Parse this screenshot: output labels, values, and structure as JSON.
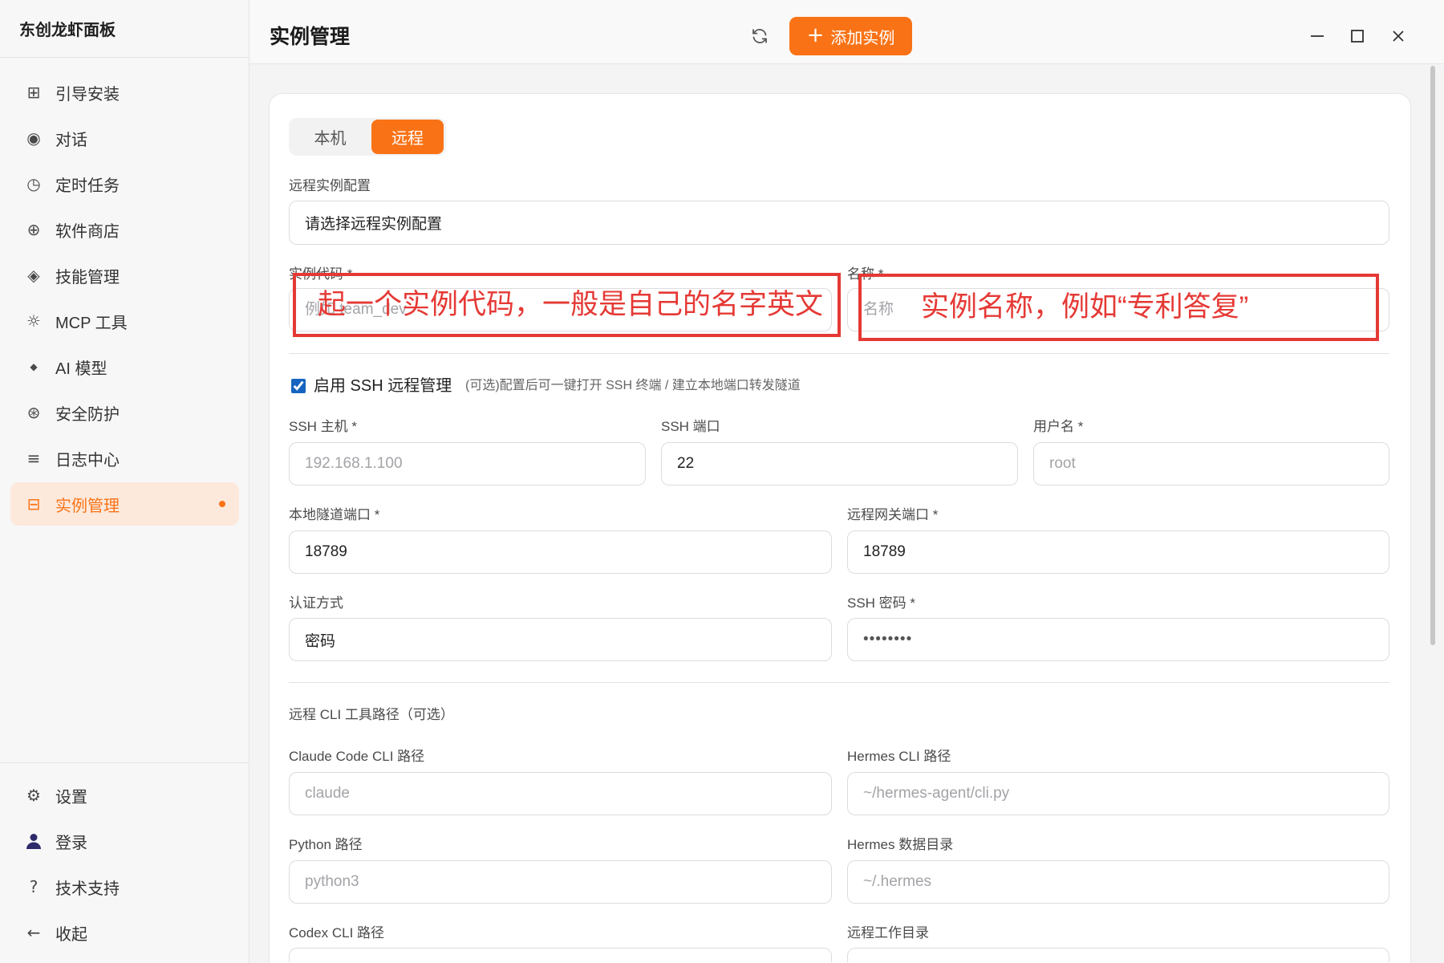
{
  "app": {
    "title": "东创龙虾面板"
  },
  "sidebar": {
    "items": [
      {
        "label": "引导安装",
        "icon": "grid-icon"
      },
      {
        "label": "对话",
        "icon": "chat-radio-icon"
      },
      {
        "label": "定时任务",
        "icon": "clock-icon"
      },
      {
        "label": "软件商店",
        "icon": "store-icon"
      },
      {
        "label": "技能管理",
        "icon": "skill-diamond-icon"
      },
      {
        "label": "MCP 工具",
        "icon": "tool-sun-icon"
      },
      {
        "label": "AI 模型",
        "icon": "model-diamond-icon"
      },
      {
        "label": "安全防护",
        "icon": "shield-star-icon"
      },
      {
        "label": "日志中心",
        "icon": "log-lines-icon"
      },
      {
        "label": "实例管理",
        "icon": "instance-icon",
        "active": true
      }
    ],
    "footer_items": [
      {
        "label": "设置",
        "icon": "gear-icon"
      },
      {
        "label": "登录",
        "icon": "user-icon"
      },
      {
        "label": "技术支持",
        "icon": "help-icon"
      },
      {
        "label": "收起",
        "icon": "arrow-left-icon"
      }
    ]
  },
  "header": {
    "title": "实例管理",
    "add_button_label": "添加实例"
  },
  "mode_tabs": {
    "items": [
      "本机",
      "远程"
    ],
    "active_index": 1
  },
  "remote_config": {
    "label": "远程实例配置",
    "value": "请选择远程实例配置"
  },
  "instance_code": {
    "label": "实例代码 *",
    "placeholder": "例如 team_dev"
  },
  "instance_name": {
    "label": "名称 *",
    "placeholder": "名称"
  },
  "annotations": {
    "code_note": "起一个实例代码，一般是自己的名字英文",
    "name_note": "实例名称，例如“专利答复”"
  },
  "ssh": {
    "enabled": true,
    "enable_label": "启用 SSH 远程管理",
    "hint": "(可选)配置后可一键打开 SSH 终端 / 建立本地端口转发隧道",
    "host": {
      "label": "SSH 主机 *",
      "placeholder": "192.168.1.100"
    },
    "port": {
      "label": "SSH 端口",
      "value": "22"
    },
    "username": {
      "label": "用户名 *",
      "placeholder": "root"
    },
    "local_tunnel_port": {
      "label": "本地隧道端口 *",
      "value": "18789"
    },
    "remote_gateway_port": {
      "label": "远程网关端口 *",
      "value": "18789"
    },
    "auth_method": {
      "label": "认证方式",
      "value": "密码"
    },
    "password": {
      "label": "SSH 密码 *",
      "value": "••••••••"
    }
  },
  "cli_paths": {
    "section_title": "远程 CLI 工具路径（可选）",
    "claude": {
      "label": "Claude Code CLI 路径",
      "placeholder": "claude"
    },
    "hermes_cli": {
      "label": "Hermes CLI 路径",
      "placeholder": "~/hermes-agent/cli.py"
    },
    "python": {
      "label": "Python 路径",
      "placeholder": "python3"
    },
    "hermes_data": {
      "label": "Hermes 数据目录",
      "placeholder": "~/.hermes"
    },
    "codex": {
      "label": "Codex CLI 路径"
    },
    "remote_workdir": {
      "label": "远程工作目录"
    }
  },
  "colors": {
    "accent": "#f97316",
    "annotation": "#e53935",
    "checkbox": "#1565c0"
  }
}
